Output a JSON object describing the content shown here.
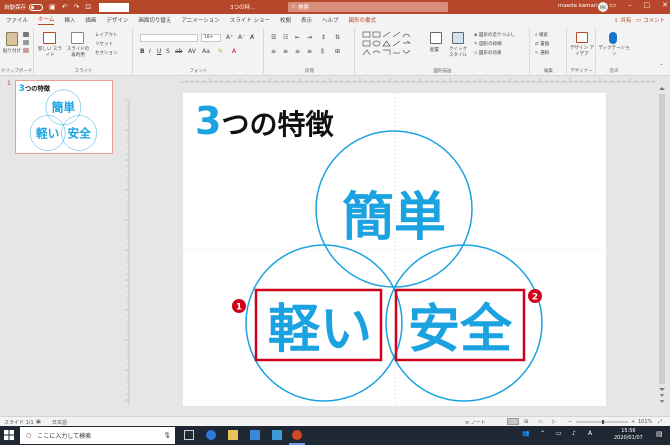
{
  "titlebar": {
    "autosave_label": "自動保存",
    "autosave_state": "オフ",
    "doc_title": "3つの特…",
    "search_placeholder": "検索",
    "user_name": "maeda kamari",
    "user_initials": "MK",
    "bg_color": "#b7472a"
  },
  "ribbon": {
    "tabs": [
      {
        "label": "ファイル"
      },
      {
        "label": "ホーム"
      },
      {
        "label": "挿入"
      },
      {
        "label": "描画"
      },
      {
        "label": "デザイン"
      },
      {
        "label": "画面切り替え"
      },
      {
        "label": "アニメーション"
      },
      {
        "label": "スライド ショー"
      },
      {
        "label": "校閲"
      },
      {
        "label": "表示"
      },
      {
        "label": "ヘルプ"
      },
      {
        "label": "図形の書式"
      }
    ],
    "share_label": "共有",
    "comment_label": "コメント",
    "groups": {
      "clipboard": "クリップボード",
      "slides": "スライド",
      "font": "フォント",
      "paragraph": "段落",
      "drawing": "図形描画",
      "editing": "編集",
      "designer": "デザイナー",
      "voice": "音声"
    },
    "buttons": {
      "paste": "貼り付け",
      "new_slide": "新しい スライド",
      "reuse_slide": "スライドの 再利用",
      "layout": "レイアウト",
      "reset": "リセット",
      "section": "セクション",
      "font_size": "18+",
      "arrange": "配置",
      "quick_styles": "クイック スタイル",
      "shape_fill": "図形の塗りつぶし",
      "shape_outline": "図形の枠線",
      "shape_effects": "図形の効果",
      "find": "検索",
      "replace": "置換",
      "select": "選択",
      "design_ideas": "デザイン アイデア",
      "dictate": "ディクテーション"
    }
  },
  "thumbnail": {
    "number": "1"
  },
  "slide": {
    "title_number": "3",
    "title_text": "つの特徴",
    "circles": {
      "top": "簡単",
      "left": "軽い",
      "right": "安全"
    },
    "markers": {
      "left": "1",
      "right": "2"
    },
    "accent_color": "#1aa3e0",
    "highlight_color": "#d0021b"
  },
  "statusbar": {
    "slide_info": "スライド 1/1",
    "language": "日本語",
    "notes": "ノート",
    "zoom": "101%"
  },
  "taskbar": {
    "search_placeholder": "ここに入力して検索",
    "time": "15:56",
    "date": "2020/01/07"
  }
}
